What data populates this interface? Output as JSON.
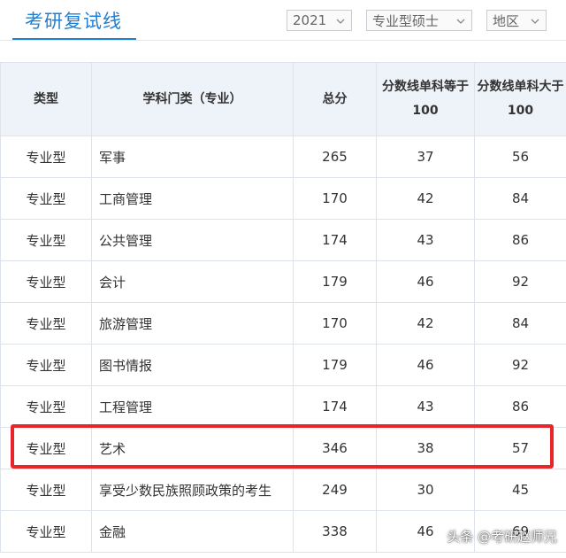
{
  "header": {
    "title": "考研复试线",
    "filters": {
      "year": "2021",
      "degree_type": "专业型硕士",
      "region": "地区"
    }
  },
  "table": {
    "columns": [
      "类型",
      "学科门类（专业）",
      "总分",
      "分数线单科等于100",
      "分数线单科大于100"
    ],
    "rows": [
      [
        "专业型",
        "军事",
        "265",
        "37",
        "56"
      ],
      [
        "专业型",
        "工商管理",
        "170",
        "42",
        "84"
      ],
      [
        "专业型",
        "公共管理",
        "174",
        "43",
        "86"
      ],
      [
        "专业型",
        "会计",
        "179",
        "46",
        "92"
      ],
      [
        "专业型",
        "旅游管理",
        "170",
        "42",
        "84"
      ],
      [
        "专业型",
        "图书情报",
        "179",
        "46",
        "92"
      ],
      [
        "专业型",
        "工程管理",
        "174",
        "43",
        "86"
      ],
      [
        "专业型",
        "艺术",
        "346",
        "38",
        "57"
      ],
      [
        "专业型",
        "享受少数民族照顾政策的考生",
        "249",
        "30",
        "45"
      ],
      [
        "专业型",
        "金融",
        "338",
        "46",
        "69"
      ]
    ],
    "highlighted_row": "艺术"
  },
  "watermark": "头条 @考研赵师兄",
  "colors": {
    "accent": "#1f7fd4",
    "header_bg": "#eef3f9",
    "highlight": "#e8252b"
  },
  "icons": {
    "dropdown": "chevron-down-icon"
  }
}
